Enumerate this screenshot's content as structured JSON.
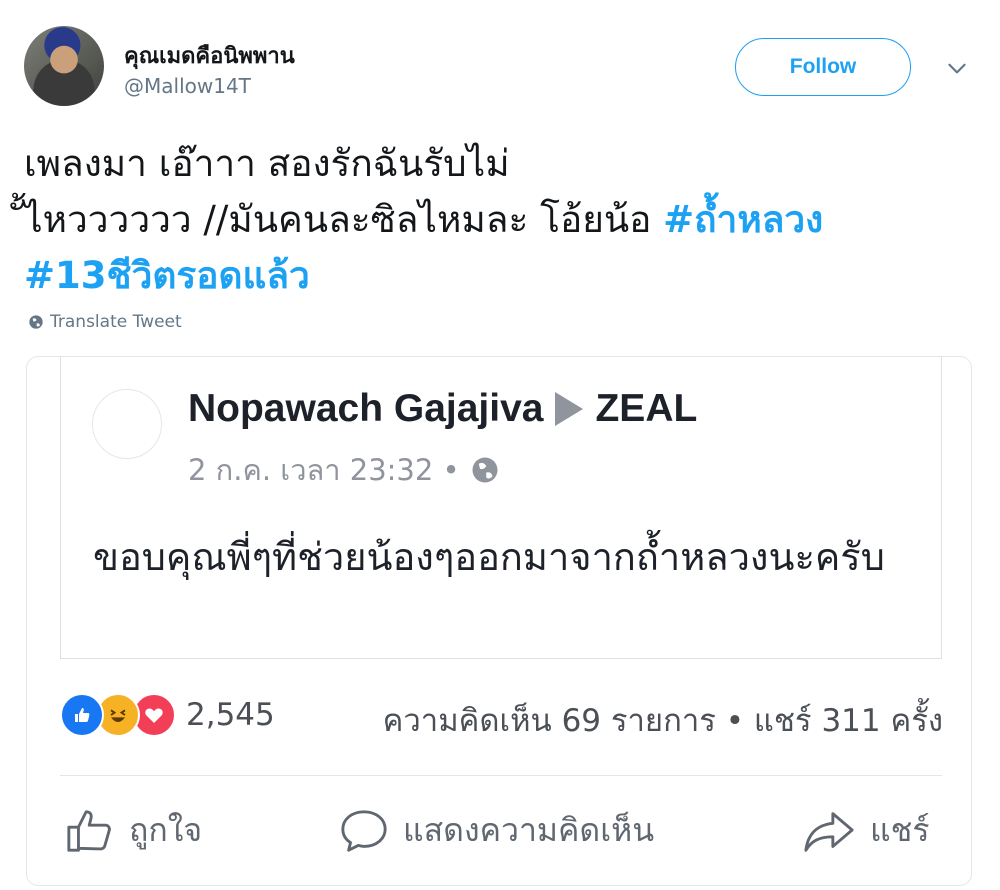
{
  "tweet": {
    "display_name": "คุณเมดคือนิพพาน",
    "handle": "@Mallow14T",
    "follow_label": "Follow",
    "text_line1": "เพลงมา เอ๊าาา สองรักฉันรับไม่",
    "text_line2_plain": "ั้ไหวววววว //มันคนละซิลไหมละ โอ้ยน้อ ",
    "hashtag1": "#ถ้ำหลวง",
    "hashtag2": "#13ชีวิตรอดแล้ว",
    "translate_label": "Translate Tweet"
  },
  "fb_post": {
    "author": "Nopawach Gajajiva",
    "target": "ZEAL",
    "timestamp": "2 ก.ค. เวลา 23:32 •",
    "body": "ขอบคุณพี่ๆที่ช่วยน้องๆออกมาจากถ้ำหลวงนะครับ",
    "reaction_count": "2,545",
    "stats": "ความคิดเห็น 69 รายการ • แชร์ 311 ครั้ง",
    "actions": {
      "like": "ถูกใจ",
      "comment": "แสดงความคิดเห็น",
      "share": "แชร์"
    }
  },
  "colors": {
    "twitter_blue": "#1da1f2",
    "fb_like": "#1877f2",
    "fb_haha": "#f7b125",
    "fb_love": "#f33e58"
  },
  "icons": [
    "avatar",
    "chevron-down-icon",
    "globe-icon",
    "like-reaction-icon",
    "haha-reaction-icon",
    "love-reaction-icon",
    "thumbs-up-icon",
    "comment-icon",
    "share-icon"
  ]
}
